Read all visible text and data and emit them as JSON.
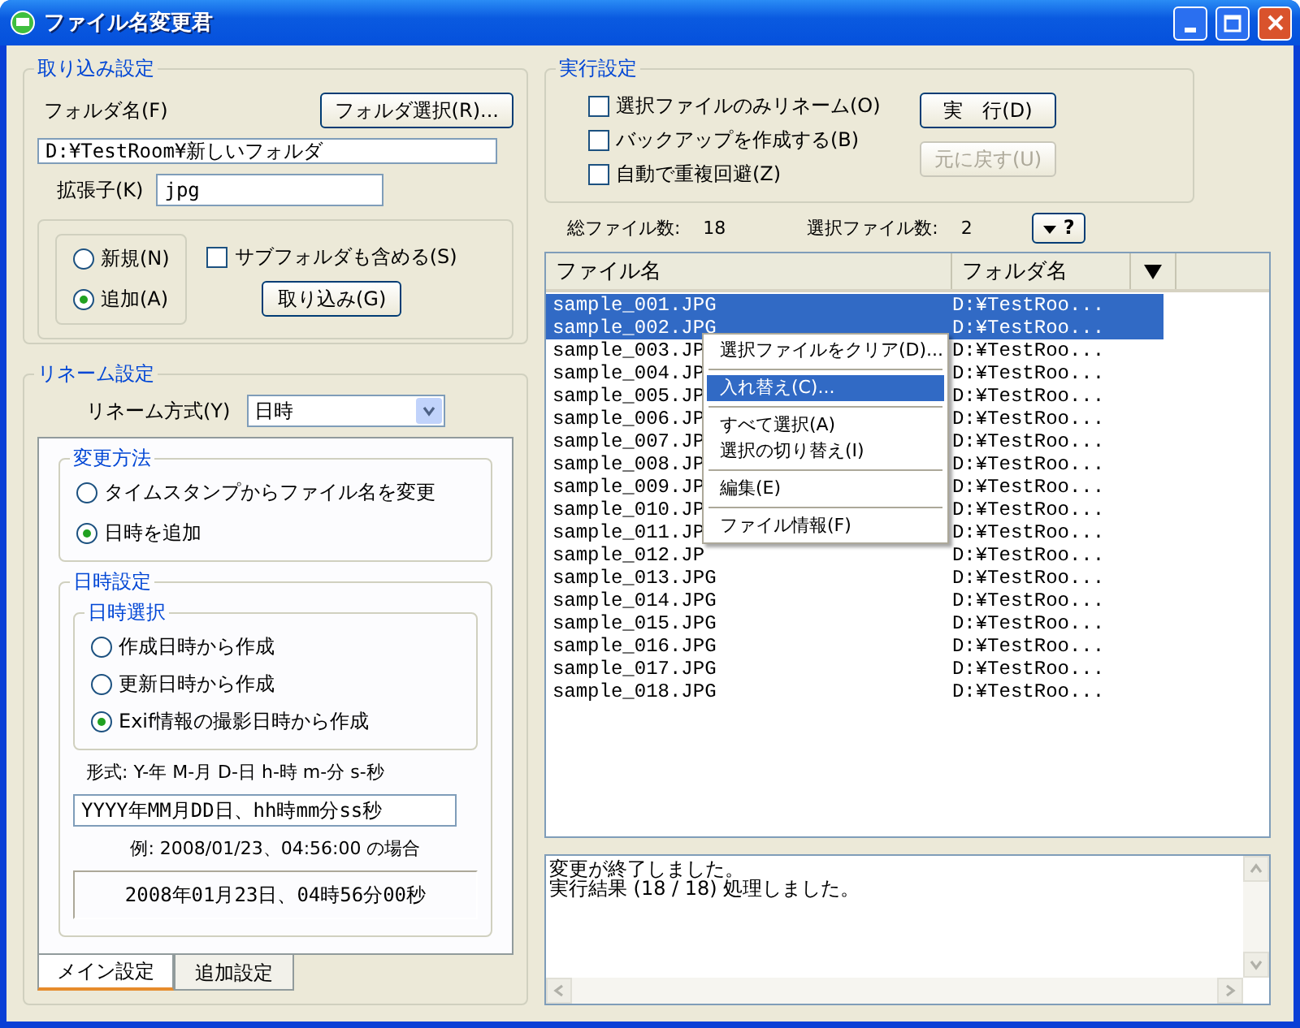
{
  "window": {
    "title": "ファイル名変更君"
  },
  "import_settings": {
    "title": "取り込み設定",
    "folder_label": "フォルダ名(F)",
    "folder_button": "フォルダ選択(R)...",
    "folder_value": "D:¥TestRoom¥新しいフォルダ",
    "extension_label": "拡張子(K)",
    "extension_value": "jpg",
    "modes": [
      {
        "label": "新規(N)",
        "selected": false
      },
      {
        "label": "追加(A)",
        "selected": true
      }
    ],
    "subfolders": {
      "label": "サブフォルダも含める(S)",
      "checked": false
    },
    "import_button": "取り込み(G)"
  },
  "rename_settings": {
    "title": "リネーム設定",
    "method_label": "リネーム方式(Y)",
    "method_value": "日時",
    "change_method": {
      "title": "変更方法",
      "options": [
        {
          "label": "タイムスタンプからファイル名を変更",
          "selected": false
        },
        {
          "label": "日時を追加",
          "selected": true
        }
      ]
    },
    "datetime": {
      "title": "日時設定",
      "select_title": "日時選択",
      "options": [
        {
          "label": "作成日時から作成",
          "selected": false
        },
        {
          "label": "更新日時から作成",
          "selected": false
        },
        {
          "label": "Exif情報の撮影日時から作成",
          "selected": true
        }
      ],
      "format_label": "形式: Y-年 M-月 D-日 h-時 m-分 s-秒",
      "format_value": "YYYY年MM月DD日、hh時mm分ss秒",
      "example_label": "例: 2008/01/23、04:56:00 の場合",
      "example_result": "2008年01月23日、04時56分00秒"
    },
    "tabs": [
      {
        "label": "メイン設定",
        "selected": true
      },
      {
        "label": "追加設定",
        "selected": false
      }
    ]
  },
  "execute_settings": {
    "title": "実行設定",
    "options": [
      {
        "label": "選択ファイルのみリネーム(O)",
        "checked": false
      },
      {
        "label": "バックアップを作成する(B)",
        "checked": false
      },
      {
        "label": "自動で重複回避(Z)",
        "checked": false
      }
    ],
    "run_button": "実　行(D)",
    "undo_button": {
      "label": "元に戻す(U)",
      "disabled": true
    }
  },
  "counts": {
    "total_label": "総ファイル数:",
    "total": "18",
    "selected_label": "選択ファイル数:",
    "selected": "2",
    "help_button": "?"
  },
  "file_list": {
    "columns": [
      "ファイル名",
      "フォルダ名"
    ],
    "rows": [
      {
        "name": "sample_001.JPG",
        "folder": "D:¥TestRoo...",
        "selected": true
      },
      {
        "name": "sample_002.JPG",
        "folder": "D:¥TestRoo...",
        "selected": true
      },
      {
        "name": "sample_003.JP",
        "folder": "D:¥TestRoo...",
        "selected": false
      },
      {
        "name": "sample_004.JP",
        "folder": "D:¥TestRoo...",
        "selected": false
      },
      {
        "name": "sample_005.JP",
        "folder": "D:¥TestRoo...",
        "selected": false
      },
      {
        "name": "sample_006.JP",
        "folder": "D:¥TestRoo...",
        "selected": false
      },
      {
        "name": "sample_007.JP",
        "folder": "D:¥TestRoo...",
        "selected": false
      },
      {
        "name": "sample_008.JP",
        "folder": "D:¥TestRoo...",
        "selected": false
      },
      {
        "name": "sample_009.JP",
        "folder": "D:¥TestRoo...",
        "selected": false
      },
      {
        "name": "sample_010.JP",
        "folder": "D:¥TestRoo...",
        "selected": false
      },
      {
        "name": "sample_011.JP",
        "folder": "D:¥TestRoo...",
        "selected": false
      },
      {
        "name": "sample_012.JP",
        "folder": "D:¥TestRoo...",
        "selected": false
      },
      {
        "name": "sample_013.JPG",
        "folder": "D:¥TestRoo...",
        "selected": false
      },
      {
        "name": "sample_014.JPG",
        "folder": "D:¥TestRoo...",
        "selected": false
      },
      {
        "name": "sample_015.JPG",
        "folder": "D:¥TestRoo...",
        "selected": false
      },
      {
        "name": "sample_016.JPG",
        "folder": "D:¥TestRoo...",
        "selected": false
      },
      {
        "name": "sample_017.JPG",
        "folder": "D:¥TestRoo...",
        "selected": false
      },
      {
        "name": "sample_018.JPG",
        "folder": "D:¥TestRoo...",
        "selected": false
      }
    ]
  },
  "context_menu": [
    {
      "kind": "item",
      "label": "選択ファイルをクリア(D)...",
      "selected": false
    },
    {
      "kind": "separator"
    },
    {
      "kind": "item",
      "label": "入れ替え(C)...",
      "selected": true
    },
    {
      "kind": "separator"
    },
    {
      "kind": "item",
      "label": "すべて選択(A)",
      "selected": false
    },
    {
      "kind": "item",
      "label": "選択の切り替え(I)",
      "selected": false
    },
    {
      "kind": "separator"
    },
    {
      "kind": "item",
      "label": "編集(E)",
      "selected": false
    },
    {
      "kind": "separator"
    },
    {
      "kind": "item",
      "label": "ファイル情報(F)",
      "selected": false
    }
  ],
  "log": [
    "変更が終了しました。",
    "実行結果 (18 / 18) 処理しました。"
  ]
}
